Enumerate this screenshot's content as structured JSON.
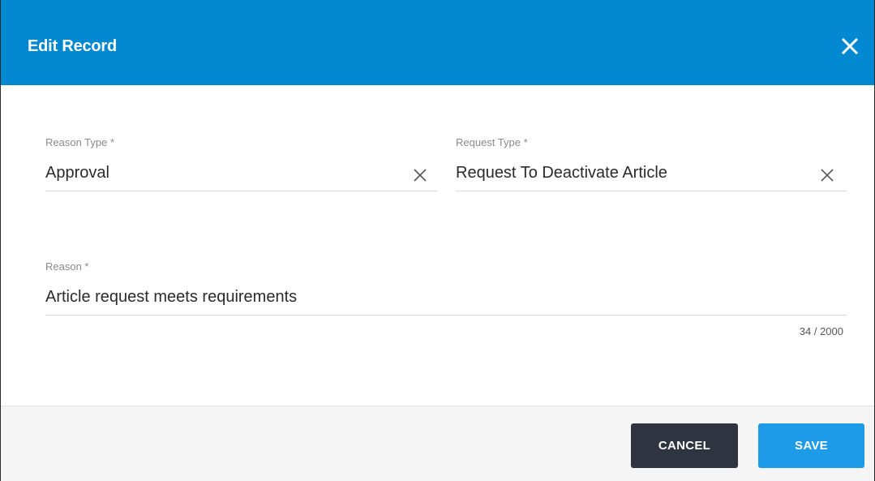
{
  "dialog": {
    "title": "Edit Record",
    "close_icon": "close-icon"
  },
  "fields": {
    "reason_type": {
      "label": "Reason Type *",
      "value": "Approval",
      "clear_icon": "clear-icon"
    },
    "request_type": {
      "label": "Request Type *",
      "value": "Request To Deactivate Article",
      "clear_icon": "clear-icon"
    },
    "reason": {
      "label": "Reason *",
      "value": "Article request meets requirements",
      "counter": "34 / 2000"
    }
  },
  "actions": {
    "cancel_label": "CANCEL",
    "save_label": "SAVE"
  },
  "colors": {
    "header": "#0288d1",
    "cancel_button": "#2e3440",
    "save_button": "#1e9be8"
  }
}
